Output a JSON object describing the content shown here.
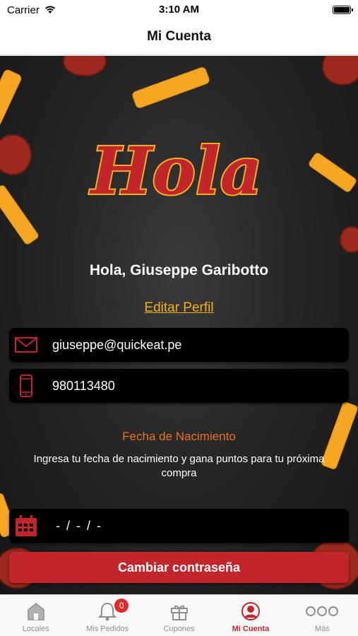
{
  "status_bar": {
    "carrier": "Carrier",
    "time": "3:10 AM"
  },
  "nav": {
    "title": "Mi Cuenta"
  },
  "hero": {
    "logo_text": "Hola"
  },
  "profile": {
    "greeting": "Hola, Giuseppe Garibotto",
    "edit_label": "Editar Perfil",
    "email": "giuseppe@quickeat.pe",
    "phone": "980113480"
  },
  "birthdate": {
    "title": "Fecha de Nacimiento",
    "description": "Ingresa tu fecha de nacimiento y gana puntos para tu próxima compra",
    "value": "- / - / -"
  },
  "actions": {
    "change_password": "Cambiar contraseña"
  },
  "tabs": [
    {
      "label": "Locales",
      "icon": "store-icon"
    },
    {
      "label": "Mis Pedidos",
      "icon": "bell-icon",
      "badge": "0"
    },
    {
      "label": "Cupones",
      "icon": "gift-icon"
    },
    {
      "label": "Mi Cuenta",
      "icon": "user-icon",
      "active": true
    },
    {
      "label": "Más",
      "icon": "more-icon"
    }
  ],
  "colors": {
    "accent_red": "#c3262a",
    "link_yellow": "#f2b01e",
    "orange_title": "#e8731f",
    "logo_red": "#c3262a",
    "logo_outline": "#f2b01e"
  }
}
